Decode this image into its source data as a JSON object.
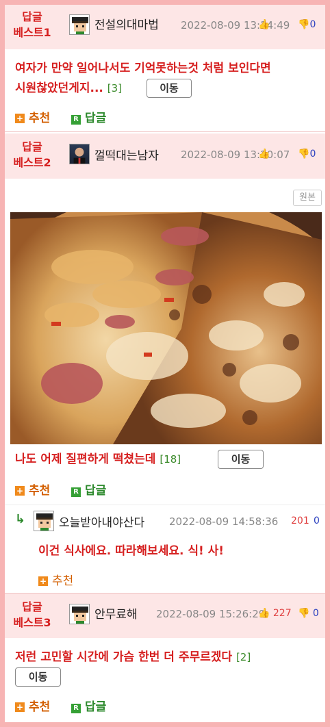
{
  "colors": {
    "border": "#f7b4b4",
    "header_bg": "#fde6e6",
    "accent_red": "#d62020",
    "recommend": "#d35f00",
    "reply": "#2e8a2e",
    "down": "#2a3fbf"
  },
  "actions": {
    "recommend_label": "추천",
    "reply_label": "답글",
    "move_label": "이동",
    "original_label": "원본"
  },
  "posts": [
    {
      "best_label": "답글\n베스트1",
      "best_top": "답글",
      "best_bottom": "베스트1",
      "nickname": "전설의대마법",
      "date": "2022-08-09 13:24:49",
      "up_count": "",
      "down_count": "0",
      "text_line1": "여자가 만약 일어나서도 기억못하는것 처럼 보인다면",
      "text_line2": "시원찮았던게지...",
      "reply_count": "[3]",
      "avatar_icon": "pixel-character-icon"
    },
    {
      "best_top": "답글",
      "best_bottom": "베스트2",
      "nickname": "껄떡대는남자",
      "date": "2022-08-09 13:20:07",
      "up_count": "",
      "down_count": "0",
      "text": "나도 어제 질편하게 떡쳤는데",
      "reply_count": "[18]",
      "avatar_icon": "photo-avatar-icon",
      "image_alt": "pizza-photo",
      "reply": {
        "nickname": "오늘받아내야산다",
        "date": "2022-08-09 14:58:36",
        "up_count": "201",
        "down_count": "0",
        "text": "이건 식사에요. 따라해보세요. 식! 사!"
      }
    },
    {
      "best_top": "답글",
      "best_bottom": "베스트3",
      "nickname": "안무료해",
      "date": "2022-08-09 15:26:29",
      "up_count": "227",
      "down_count": "0",
      "text": "저런 고민할 시간에 가슴 한번 더 주무르겠다",
      "reply_count": "[2]",
      "avatar_icon": "pixel-character-icon"
    }
  ]
}
